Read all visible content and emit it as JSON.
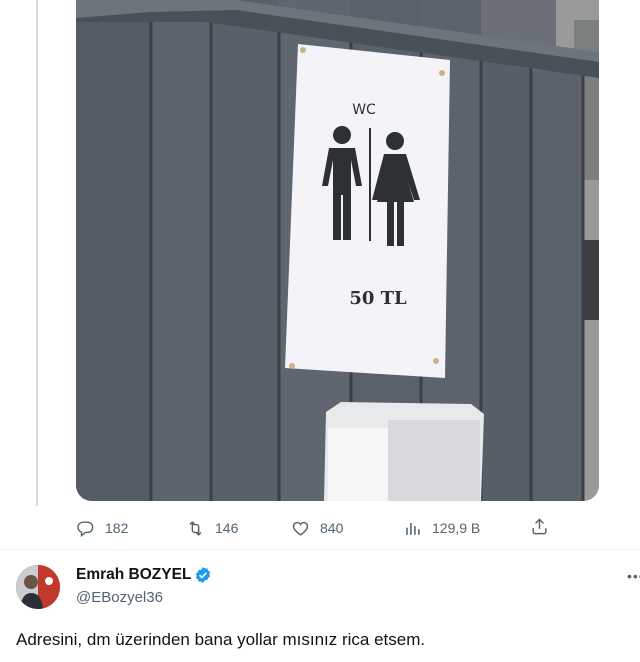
{
  "media": {
    "sign_title": "WC",
    "sign_price": "50 TL"
  },
  "actions": {
    "reply_count": "182",
    "retweet_count": "146",
    "like_count": "840",
    "views_count": "129,9 B"
  },
  "reply_tweet": {
    "display_name": "Emrah BOZYEL",
    "handle": "@EBozyel36",
    "text": "Adresini, dm üzerinden bana yollar mısınız rica etsem."
  },
  "icons": {
    "reply": "reply-icon",
    "retweet": "retweet-icon",
    "like": "heart-icon",
    "views": "views-icon",
    "share": "share-icon",
    "verified": "verified-badge-icon",
    "more": "more-icon"
  },
  "colors": {
    "icon_gray": "#536471",
    "verified_blue": "#1d9bf0",
    "text": "#0f1419"
  }
}
